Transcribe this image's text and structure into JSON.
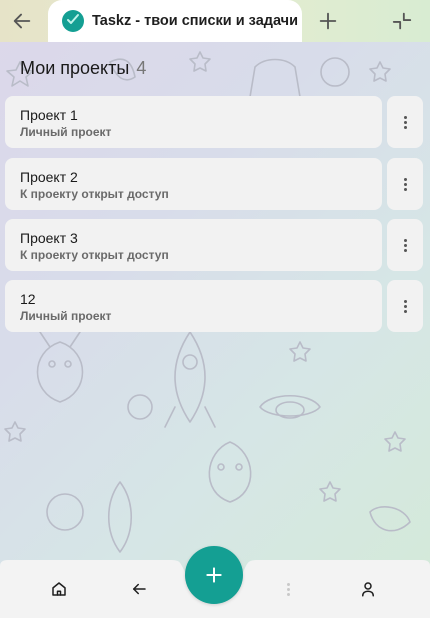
{
  "browser": {
    "active_tab_title": "Taskz - твои списки и задачи",
    "logo_text": "Taskz",
    "icons": [
      "back-icon",
      "plus-icon",
      "collapse-icon"
    ]
  },
  "page": {
    "title": "Мои проекты",
    "count": "4"
  },
  "projects": [
    {
      "name": "Проект 1",
      "subtitle": "Личный проект"
    },
    {
      "name": "Проект 2",
      "subtitle": "К проекту открыт доступ"
    },
    {
      "name": "Проект 3",
      "subtitle": "К проекту открыт доступ"
    },
    {
      "name": "12",
      "subtitle": "Личный проект"
    }
  ],
  "bottom_nav": {
    "items": [
      "home-icon",
      "back-arrow-icon",
      "add-icon",
      "more-icon",
      "profile-icon"
    ]
  },
  "colors": {
    "accent": "#149f93",
    "card": "#f2f2f2",
    "tab_bar": "#e4ead0"
  }
}
